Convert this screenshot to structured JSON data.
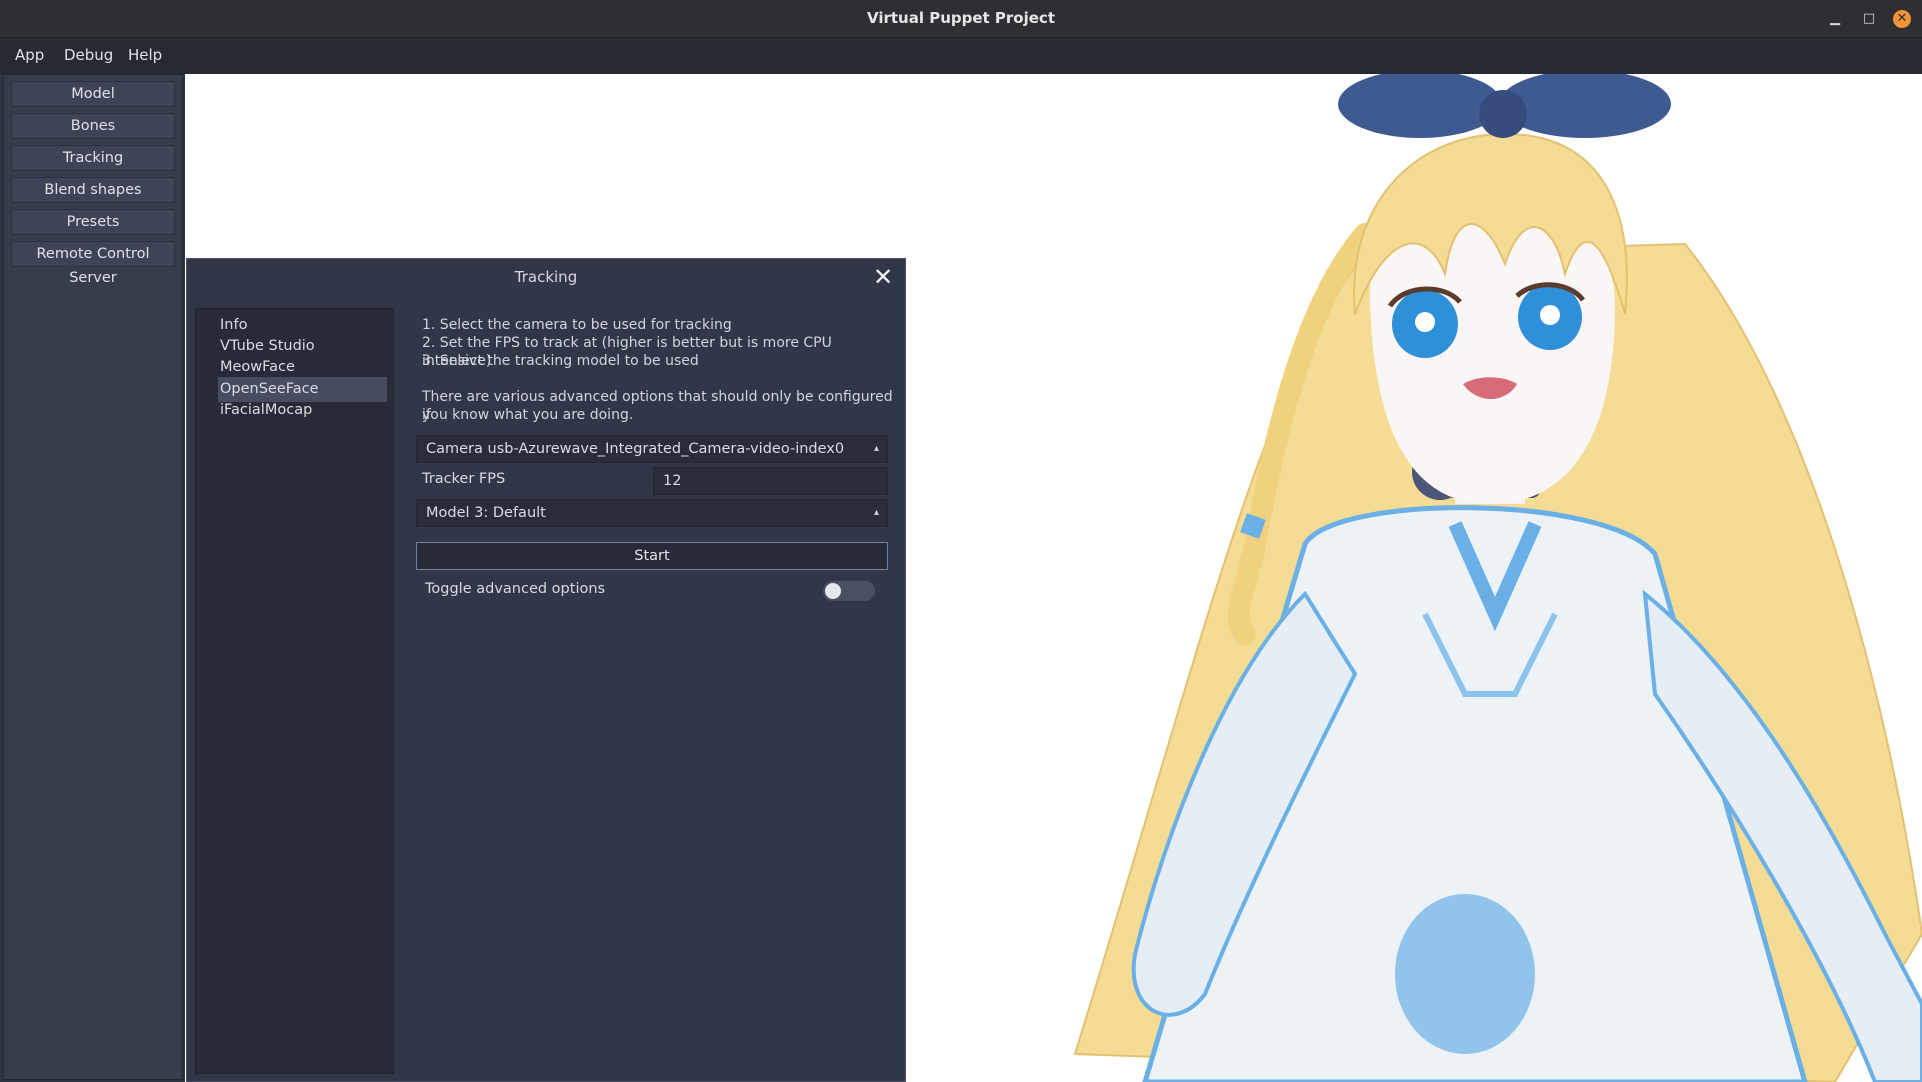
{
  "window": {
    "title": "Virtual Puppet Project"
  },
  "menubar": {
    "items": [
      "App",
      "Debug",
      "Help"
    ]
  },
  "sidebar": {
    "buttons": [
      "Model",
      "Bones",
      "Tracking",
      "Blend shapes",
      "Presets",
      "Remote Control Server"
    ]
  },
  "dialog": {
    "title": "Tracking",
    "list": [
      "Info",
      "VTube Studio",
      "MeowFace",
      "OpenSeeFace",
      "iFacialMocap"
    ],
    "selected": "OpenSeeFace",
    "instructions": [
      "1. Select the camera to be used for tracking",
      "2. Set the FPS to track at (higher is better but is more CPU intensive)",
      "3. Select the tracking model to be used"
    ],
    "advanced_note_line1": "There are various advanced options that should only be configured if",
    "advanced_note_line2": "you know what you are doing.",
    "camera_select": "Camera usb-Azurewave_Integrated_Camera-video-index0",
    "fps_label": "Tracker FPS",
    "fps_value": "12",
    "model_select": "Model 3: Default",
    "start_label": "Start",
    "toggle_label": "Toggle advanced options",
    "toggle_on": false
  },
  "colors": {
    "hair": "#f5dc94",
    "ribbon": "#3f5a90",
    "dress_accent": "#6ab0e6",
    "eyes": "#2f8fd8"
  }
}
